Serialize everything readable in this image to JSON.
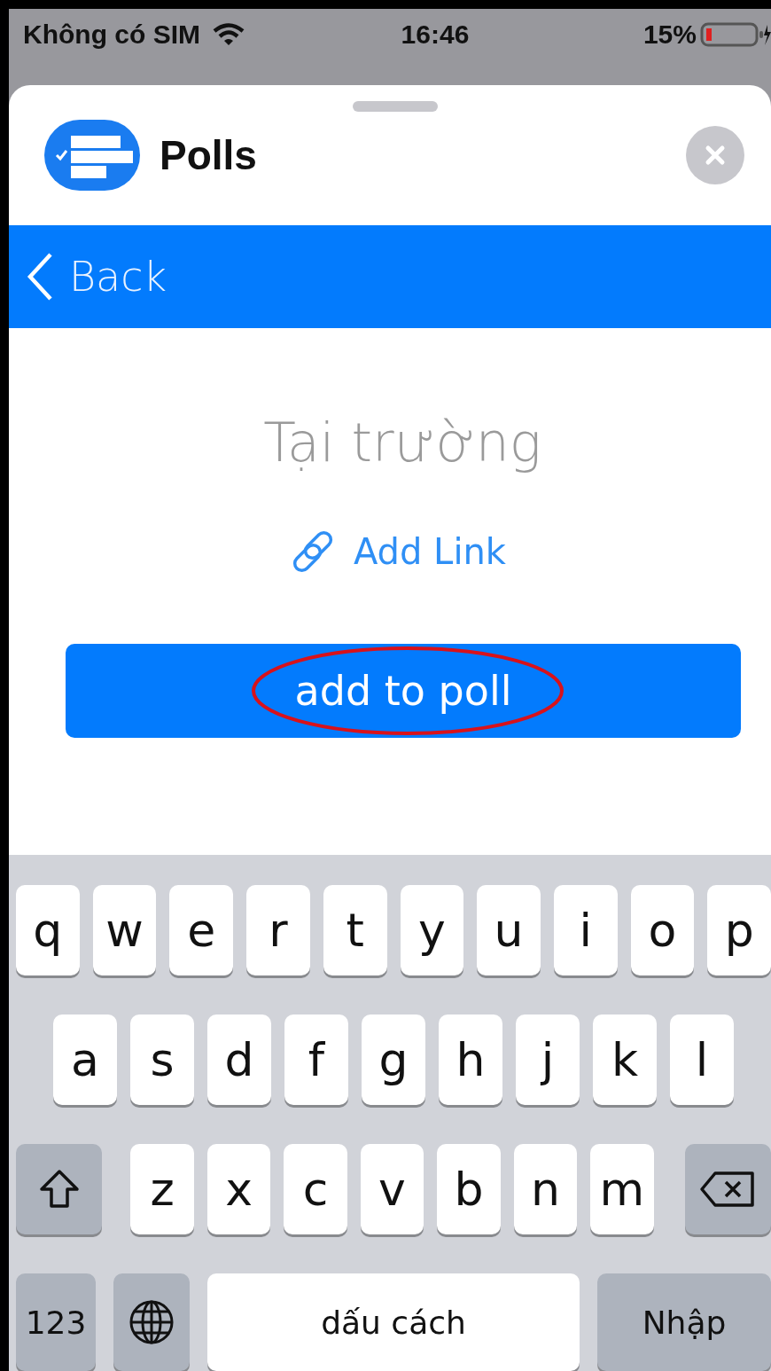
{
  "status_bar": {
    "carrier": "Không có SIM",
    "time": "16:46",
    "battery": "15%"
  },
  "sheet": {
    "title": "Polls"
  },
  "nav_bar": {
    "back": "Back"
  },
  "content": {
    "poll_option": "Tại trường",
    "add_link": "Add Link",
    "button": "add to poll"
  },
  "keyboard": {
    "rows": [
      [
        {
          "kind": "letter",
          "label": "q"
        },
        {
          "kind": "letter",
          "label": "w"
        },
        {
          "kind": "letter",
          "label": "e"
        },
        {
          "kind": "letter",
          "label": "r"
        },
        {
          "kind": "letter",
          "label": "t"
        },
        {
          "kind": "letter",
          "label": "y"
        },
        {
          "kind": "letter",
          "label": "u"
        },
        {
          "kind": "letter",
          "label": "i"
        },
        {
          "kind": "letter",
          "label": "o"
        },
        {
          "kind": "letter",
          "label": "p"
        }
      ],
      [
        {
          "kind": "letter",
          "label": "a"
        },
        {
          "kind": "letter",
          "label": "s"
        },
        {
          "kind": "letter",
          "label": "d"
        },
        {
          "kind": "letter",
          "label": "f"
        },
        {
          "kind": "letter",
          "label": "g"
        },
        {
          "kind": "letter",
          "label": "h"
        },
        {
          "kind": "letter",
          "label": "j"
        },
        {
          "kind": "letter",
          "label": "k"
        },
        {
          "kind": "letter",
          "label": "l"
        }
      ],
      [
        {
          "kind": "shift"
        },
        {
          "kind": "letter",
          "label": "z"
        },
        {
          "kind": "letter",
          "label": "x"
        },
        {
          "kind": "letter",
          "label": "c"
        },
        {
          "kind": "letter",
          "label": "v"
        },
        {
          "kind": "letter",
          "label": "b"
        },
        {
          "kind": "letter",
          "label": "n"
        },
        {
          "kind": "letter",
          "label": "m"
        },
        {
          "kind": "delete"
        }
      ]
    ],
    "bottom_row": {
      "numbers_key": "123",
      "space_key": "dấu cách",
      "return_key": "Nhập"
    }
  }
}
